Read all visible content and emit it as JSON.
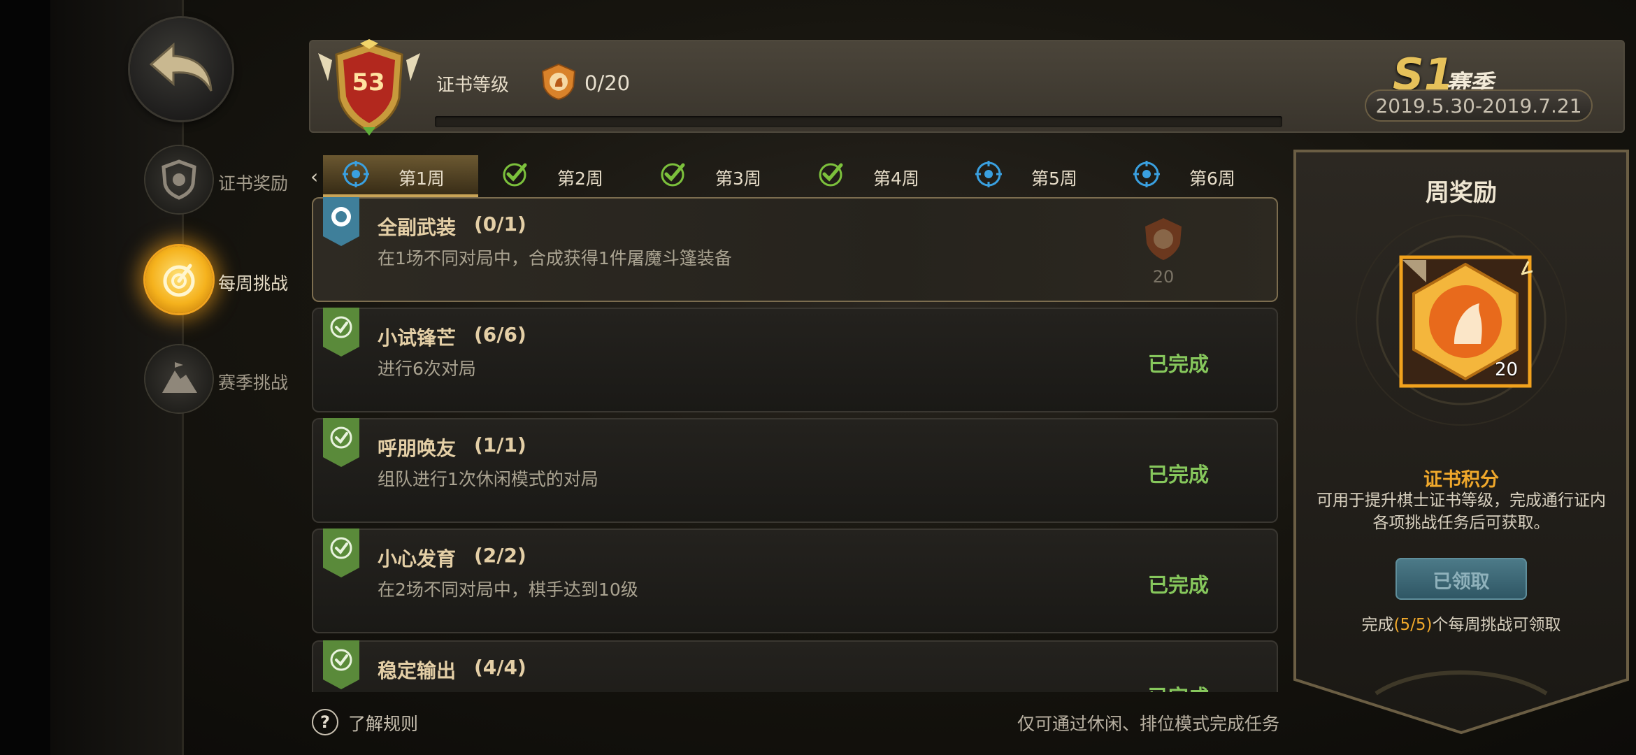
{
  "nav": {
    "items": [
      {
        "label": "证书奖励"
      },
      {
        "label": "每周挑战"
      },
      {
        "label": "赛季挑战"
      }
    ]
  },
  "header": {
    "level": "53",
    "cert_label": "证书等级",
    "points": "0/20",
    "progress": 0
  },
  "season": {
    "code": "S1",
    "word": "赛季",
    "dates": "2019.5.30-2019.7.21"
  },
  "weeks": [
    {
      "label": "第1周",
      "status": "target"
    },
    {
      "label": "第2周",
      "status": "done"
    },
    {
      "label": "第3周",
      "status": "done"
    },
    {
      "label": "第4周",
      "status": "done"
    },
    {
      "label": "第5周",
      "status": "target"
    },
    {
      "label": "第6周",
      "status": "target"
    }
  ],
  "tasks": [
    {
      "title": "全副武装",
      "progress": "(0/1)",
      "desc": "在1场不同对局中，合成获得1件屠魔斗篷装备",
      "reward": "20"
    },
    {
      "title": "小试锋芒",
      "progress": "(6/6)",
      "desc": "进行6次对局",
      "status": "已完成"
    },
    {
      "title": "呼朋唤友",
      "progress": "(1/1)",
      "desc": "组队进行1次休闲模式的对局",
      "status": "已完成"
    },
    {
      "title": "小心发育",
      "progress": "(2/2)",
      "desc": "在2场不同对局中，棋手达到10级",
      "status": "已完成"
    },
    {
      "title": "稳定输出",
      "progress": "(4/4)",
      "desc": "",
      "status": "已完成"
    }
  ],
  "footer": {
    "help": "了解规则",
    "note": "仅可通过休闲、排位模式完成任务"
  },
  "weekly_reward": {
    "title": "周奖励",
    "amount": "20",
    "points_title": "证书积分",
    "points_desc": "可用于提升棋士证书等级，完成通行证内各项挑战任务后可获取。",
    "button": "已领取",
    "cond_pre": "完成",
    "cond_hl": "(5/5)",
    "cond_post": "个每周挑战可领取"
  },
  "colors": {
    "accent_gold": "#e6c15a",
    "complete_green": "#86c75c",
    "points_orange": "#f0a82b",
    "target_blue": "#3aa0e0",
    "check_green": "#7cc13c"
  }
}
